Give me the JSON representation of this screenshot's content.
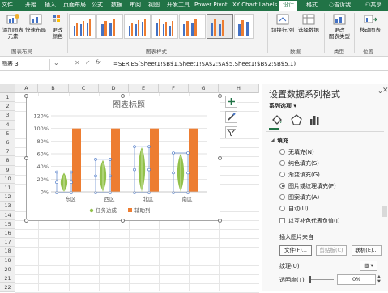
{
  "ribbon_tabs": {
    "file": "文件",
    "start": "开始",
    "insert": "插入",
    "page_layout": "页面布局",
    "formulas": "公式",
    "data": "数据",
    "review": "审阅",
    "view": "视图",
    "developer": "开发工具",
    "power_pivot": "Power Pivot",
    "xy_chart_labels": "XY Chart Labels",
    "design": "设计",
    "format": "格式",
    "tell_me": "告诉我",
    "share": "共享"
  },
  "ribbon": {
    "add_element": "添加图表\n元素",
    "quick_layout": "快速布局",
    "change_colors": "更改\n颜色",
    "layout_group": "图表布局",
    "styles_group": "图表样式",
    "switch_rowcol": "切换行/列",
    "select_data": "选择数据",
    "data_group": "数据",
    "change_type": "更改\n图表类型",
    "type_group": "类型",
    "move_chart": "移动图表",
    "location_group": "位置"
  },
  "formula_bar": {
    "name_box": "图表 3",
    "formula": "=SERIES(Sheet1!$B$1,Sheet1!$A$2:$A$5,Sheet1!$B$2:$B$5,1)"
  },
  "sheet": {
    "columns": [
      "A",
      "B",
      "C",
      "D",
      "E",
      "F",
      "G",
      "H"
    ],
    "rows": [
      "1",
      "2",
      "3",
      "4",
      "5",
      "6",
      "7",
      "8",
      "9",
      "10",
      "11",
      "12",
      "13",
      "14",
      "15",
      "16",
      "17",
      "18",
      "19",
      "20",
      "21",
      "22"
    ]
  },
  "chart_data": {
    "type": "bar",
    "title": "图表标题",
    "categories": [
      "东区",
      "西区",
      "北区",
      "南区"
    ],
    "ylim": [
      0,
      1.2
    ],
    "yticks": [
      "0%",
      "20%",
      "40%",
      "60%",
      "80%",
      "100%",
      "120%"
    ],
    "series": [
      {
        "name": "任务达成",
        "values": [
          0.3,
          0.5,
          0.7,
          0.6
        ],
        "color": "#92c14b",
        "marker": "leaf"
      },
      {
        "name": "辅助列",
        "values": [
          1.0,
          1.0,
          1.0,
          1.0
        ],
        "color": "#ed7d31"
      }
    ],
    "legend": "bottom",
    "grid": true
  },
  "pane": {
    "title": "设置数据系列格式",
    "options_label": "系列选项",
    "section": "填充",
    "fill_none": "无填充(N)",
    "fill_solid": "纯色填充(S)",
    "fill_gradient": "渐变填充(G)",
    "fill_picture": "图片或纹理填充(P)",
    "fill_pattern": "图案填充(A)",
    "fill_auto": "自动(U)",
    "invert": "以互补色代表负值(I)",
    "insert_from": "插入图片来自",
    "file_button": "文件(F)...",
    "clipboard_button": "剪贴板(C)",
    "online_button": "联机(E)...",
    "texture_label": "纹理(U)",
    "transparency_label": "透明度(T)",
    "transparency_value": "0%"
  },
  "colors": {
    "excel_green": "#217346",
    "leaf_green": "#92c14b",
    "orange": "#ed7d31"
  }
}
